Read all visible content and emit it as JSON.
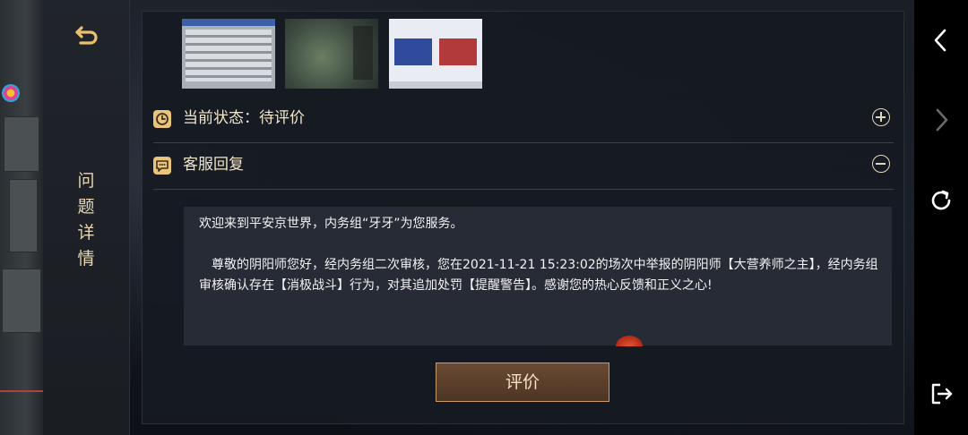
{
  "nav": {
    "back_icon": "back-arrow-icon",
    "title_chars": [
      "问",
      "题",
      "详",
      "情"
    ]
  },
  "detail": {
    "status_icon": "clock-icon",
    "status_label": "当前状态：待评价",
    "status_toggle_icon": "plus-circle-icon",
    "reply_icon": "chat-bubble-icon",
    "reply_label": "客服回复",
    "reply_toggle_icon": "minus-circle-icon",
    "reply_text": {
      "greeting": "欢迎来到平安京世界，内务组“牙牙”为您服务。",
      "body": "　尊敬的阴阳师您好，经内务组二次审核，您在2021-11-21 15:23:02的场次中举报的阴阳师【大营养师之主】，经内务组审核确认存在【消极战斗】行为，对其追加处罚【提醒警告】。感谢您的热心反馈和正义之心!"
    },
    "evaluate_button": "评价"
  },
  "system_bar": {
    "icons": [
      "chevron-left-icon",
      "chevron-right-icon",
      "refresh-icon",
      "exit-icon"
    ]
  },
  "colors": {
    "accent_gold": "#e9c47a",
    "button_brown": "#5c402c",
    "panel_dark": "#161a21"
  }
}
